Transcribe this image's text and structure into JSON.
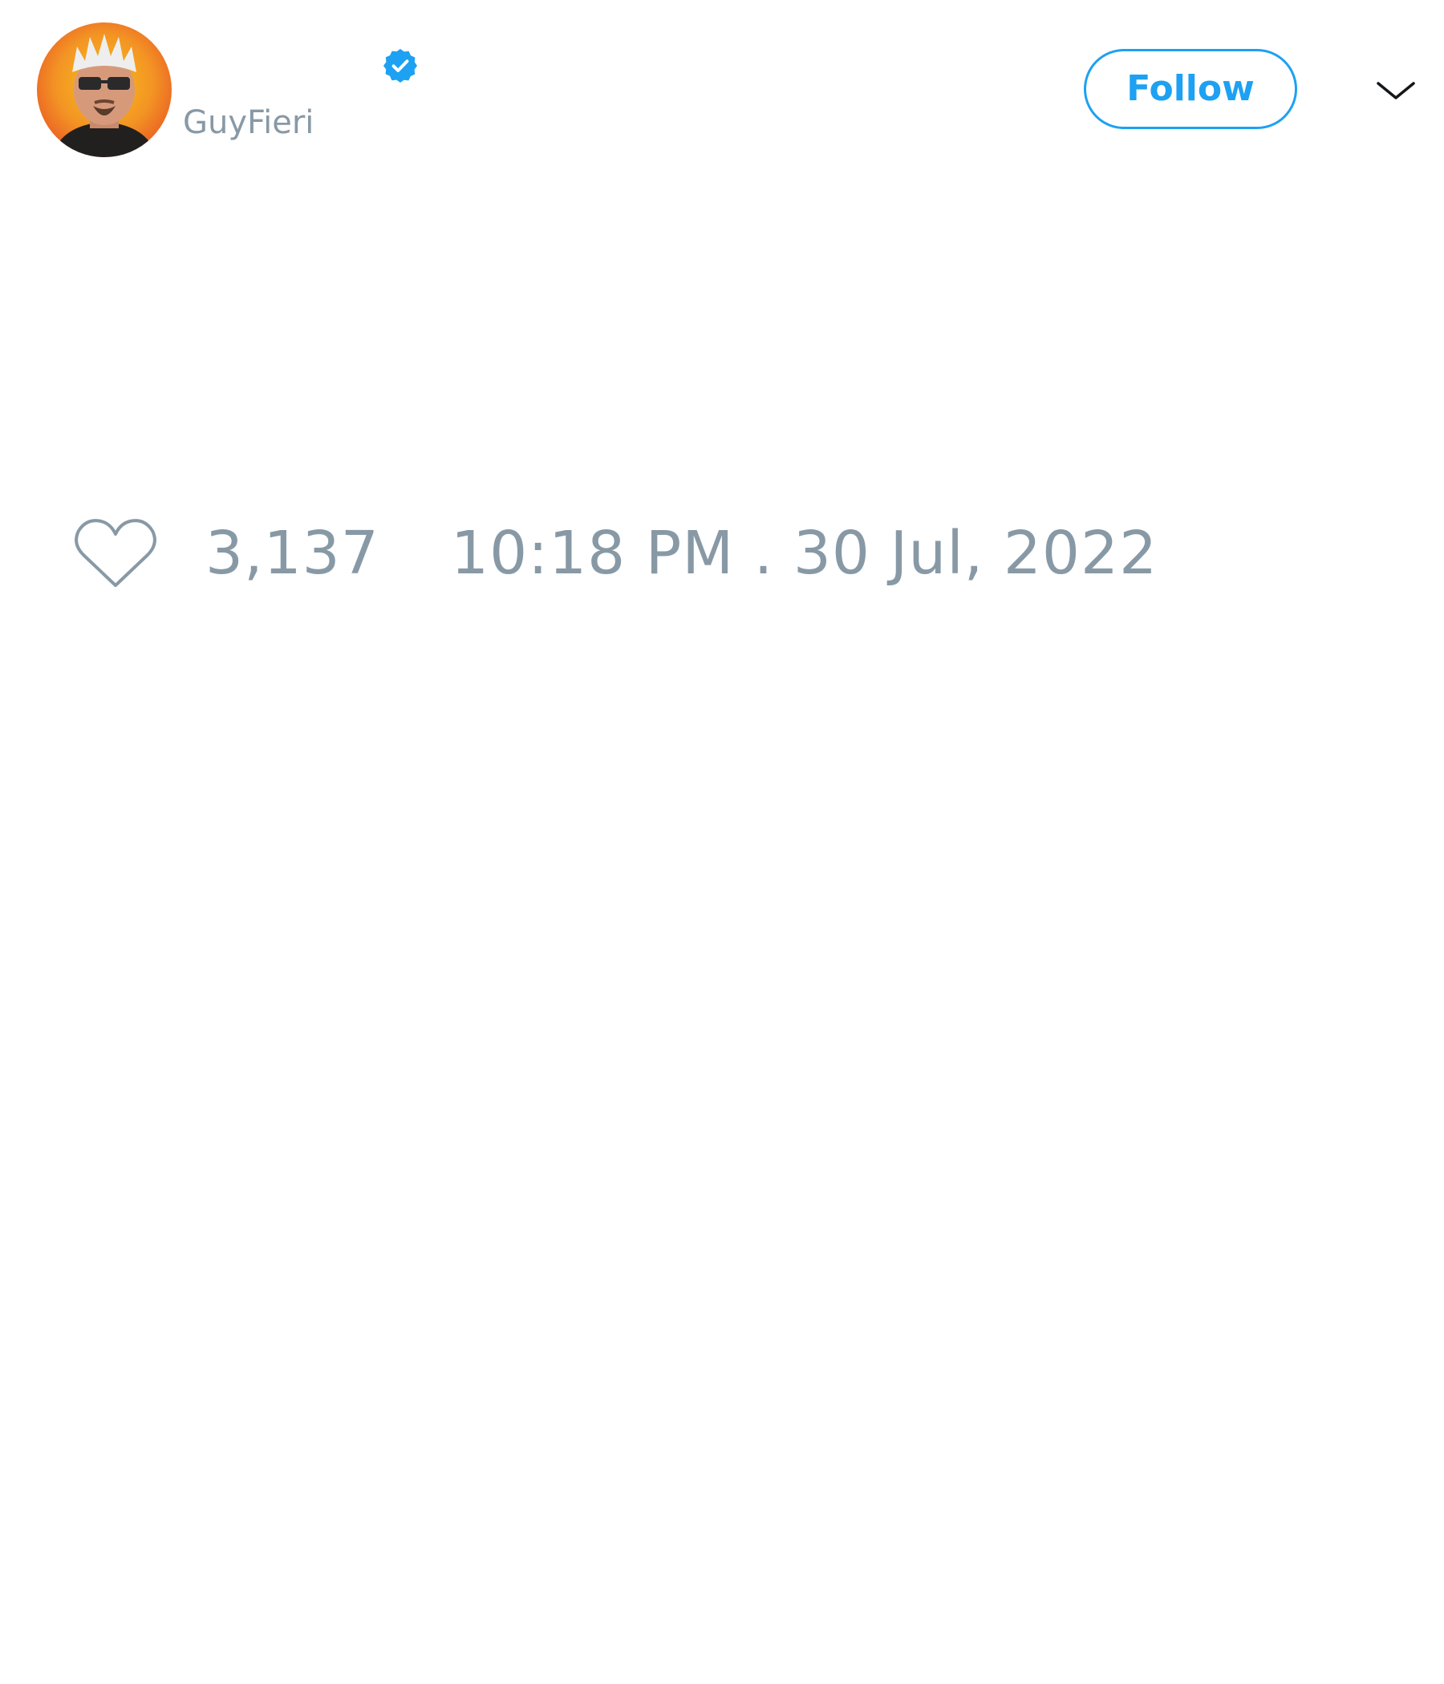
{
  "tweet": {
    "author": {
      "display_name": "",
      "handle": "GuyFieri",
      "verified": true,
      "avatar_icon": "profile-photo"
    },
    "follow_label": "Follow",
    "menu_icon": "chevron-down-icon",
    "text": "",
    "likes": "3,137",
    "timestamp": "10:18 PM . 30 Jul, 2022"
  },
  "colors": {
    "accent": "#1da1f2",
    "muted_text": "#8899a6",
    "background": "#ffffff"
  }
}
